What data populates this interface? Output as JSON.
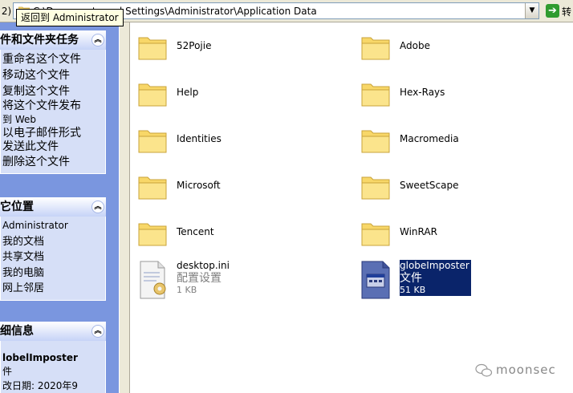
{
  "address_bar": {
    "left_button": "2)",
    "path": "C:\\Documents and Settings\\Administrator\\Application Data",
    "go_label": "转"
  },
  "tooltip": {
    "text": "返回到 Administrator"
  },
  "task_pane": {
    "file_tasks": {
      "title": "件和文件夹任务",
      "items": [
        "重命名这个文件",
        "移动这个文件",
        "复制这个文件",
        "将这个文件发布",
        "到 Web",
        "以电子邮件形式",
        "发送此文件",
        "删除这个文件"
      ]
    },
    "other_places": {
      "title": "它位置",
      "items": [
        "Administrator",
        "我的文档",
        "共享文档",
        "我的电脑",
        "网上邻居"
      ]
    },
    "details": {
      "title": "细信息",
      "name": "lobelImposter",
      "type": "件",
      "modified": "改日期: 2020年9"
    }
  },
  "folders": [
    "52Pojie",
    "Adobe",
    "Help",
    "Hex-Rays",
    "Identities",
    "Macromedia",
    "Microsoft",
    "SweetScape",
    "Tencent",
    "WinRAR"
  ],
  "files": [
    {
      "name": "desktop.ini",
      "type": "配置设置",
      "size": "1 KB",
      "icon": "ini-settings-icon"
    },
    {
      "name": "globeImposter",
      "type": "文件",
      "size": "51 KB",
      "icon": "generic-file-icon"
    }
  ],
  "watermark": {
    "text": "moonsec"
  },
  "colors": {
    "task_pane_bg": "#7a96df",
    "selection": "#0a246a",
    "folder": "#f8d768"
  }
}
